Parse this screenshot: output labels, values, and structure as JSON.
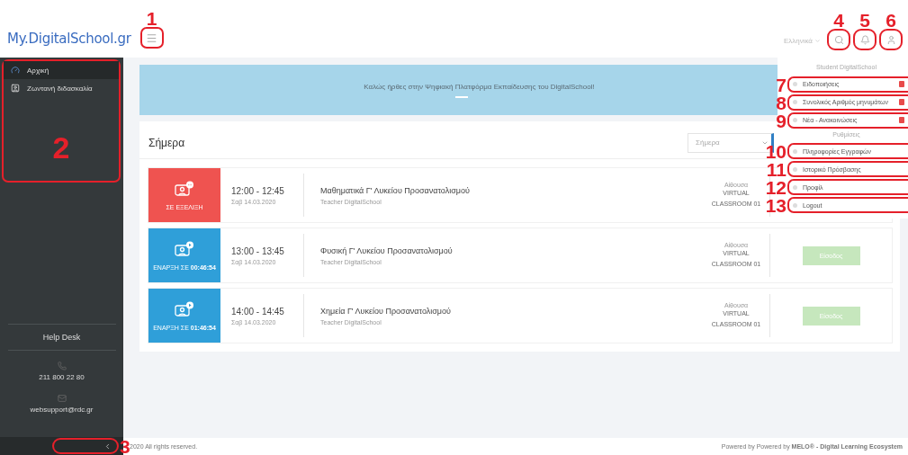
{
  "header": {
    "logo": "My.DigitalSchool.gr",
    "menu_callout": "1",
    "language": "Ελληνικά",
    "icon_callouts": [
      "4",
      "5",
      "6"
    ]
  },
  "sidebar": {
    "callout": "2",
    "items": [
      {
        "label": "Αρχική",
        "selected": true
      },
      {
        "label": "Ζωντανή διδασκαλία",
        "selected": false
      }
    ],
    "helpdesk_title": "Help Desk",
    "phone": "211 800 22 80",
    "email": "websupport@rdc.gr",
    "collapse_callout": "3"
  },
  "banner": {
    "text": "Καλώς ήρθες στην Ψηφιακή Πλατφόρμα Εκπαίδευσης του DigitalSchool!"
  },
  "today": {
    "title": "Σήμερα",
    "filter": {
      "value": "Σήμερα"
    },
    "lessons": [
      {
        "kind": "live",
        "status_text": "ΣΕ ΕΞΕΛΙΞΗ",
        "time": "12:00 - 12:45",
        "date": "Σαβ 14.03.2020",
        "title": "Μαθηματικά Γ' Λυκείου Προσανατολισμού",
        "teacher": "Teacher DigitalSchool",
        "room_label": "Αίθουσα",
        "room": "VIRTUAL CLASSROOM 01"
      },
      {
        "kind": "upcoming",
        "status_text": "ΕΝΑΡΞΗ ΣΕ **00:46:54**",
        "time": "13:00 - 13:45",
        "date": "Σαβ 14.03.2020",
        "title": "Φυσική Γ' Λυκείου Προσανατολισμού",
        "teacher": "Teacher DigitalSchool",
        "room_label": "Αίθουσα",
        "room": "VIRTUAL CLASSROOM 01",
        "action": "Είσοδος"
      },
      {
        "kind": "upcoming",
        "status_text": "ΕΝΑΡΞΗ ΣΕ **01:46:54**",
        "time": "14:00 - 14:45",
        "date": "Σαβ 14.03.2020",
        "title": "Χημεία Γ' Λυκείου Προσανατολισμού",
        "teacher": "Teacher DigitalSchool",
        "room_label": "Αίθουσα",
        "room": "VIRTUAL CLASSROOM 01",
        "action": "Είσοδος"
      }
    ]
  },
  "user_menu": {
    "user_name": "Student DigitalSchool",
    "items": [
      {
        "label": "Ειδοποιήσεις",
        "callout": "7",
        "badge": true
      },
      {
        "label": "Συνολικός Αριθμός μηνυμάτων",
        "callout": "8",
        "badge": true
      },
      {
        "label": "Νέα - Ανακοινώσεις",
        "callout": "9",
        "badge": true
      }
    ],
    "settings_title": "Ρυθμίσεις",
    "settings_items": [
      {
        "label": "Πληροφορίες Εγγραφών",
        "callout": "10",
        "badge": false
      },
      {
        "label": "Ιστορικό Πρόσβασης",
        "callout": "11",
        "badge": false
      },
      {
        "label": "Προφίλ",
        "callout": "12",
        "badge": false
      },
      {
        "label": "Logout",
        "callout": "13",
        "badge": false
      }
    ]
  },
  "footer": {
    "copyright": "2020 All rights reserved.",
    "powered": "Powered by Powered by **MELO® - Digital Learning Ecosystem**"
  }
}
